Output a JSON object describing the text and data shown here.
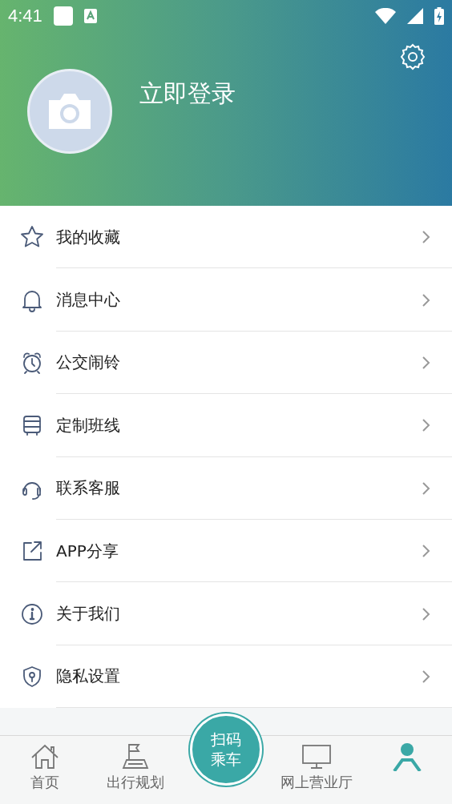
{
  "status_bar": {
    "time": "4:41"
  },
  "profile": {
    "login_label": "立即登录"
  },
  "menu": [
    {
      "kind": "star",
      "label": "我的收藏"
    },
    {
      "kind": "bell",
      "label": "消息中心"
    },
    {
      "kind": "alarm",
      "label": "公交闹铃"
    },
    {
      "kind": "bus",
      "label": "定制班线"
    },
    {
      "kind": "headset",
      "label": "联系客服"
    },
    {
      "kind": "share",
      "label": "APP分享"
    },
    {
      "kind": "info",
      "label": "关于我们"
    },
    {
      "kind": "shield",
      "label": "隐私设置"
    }
  ],
  "tabs": [
    {
      "kind": "home",
      "label": "首页",
      "selected": false
    },
    {
      "kind": "flag",
      "label": "出行规划",
      "selected": false
    },
    {
      "kind": "scan",
      "label": "扫码乘车"
    },
    {
      "kind": "monitor",
      "label": "网上营业厅",
      "selected": false
    },
    {
      "kind": "person",
      "selected": true
    }
  ]
}
